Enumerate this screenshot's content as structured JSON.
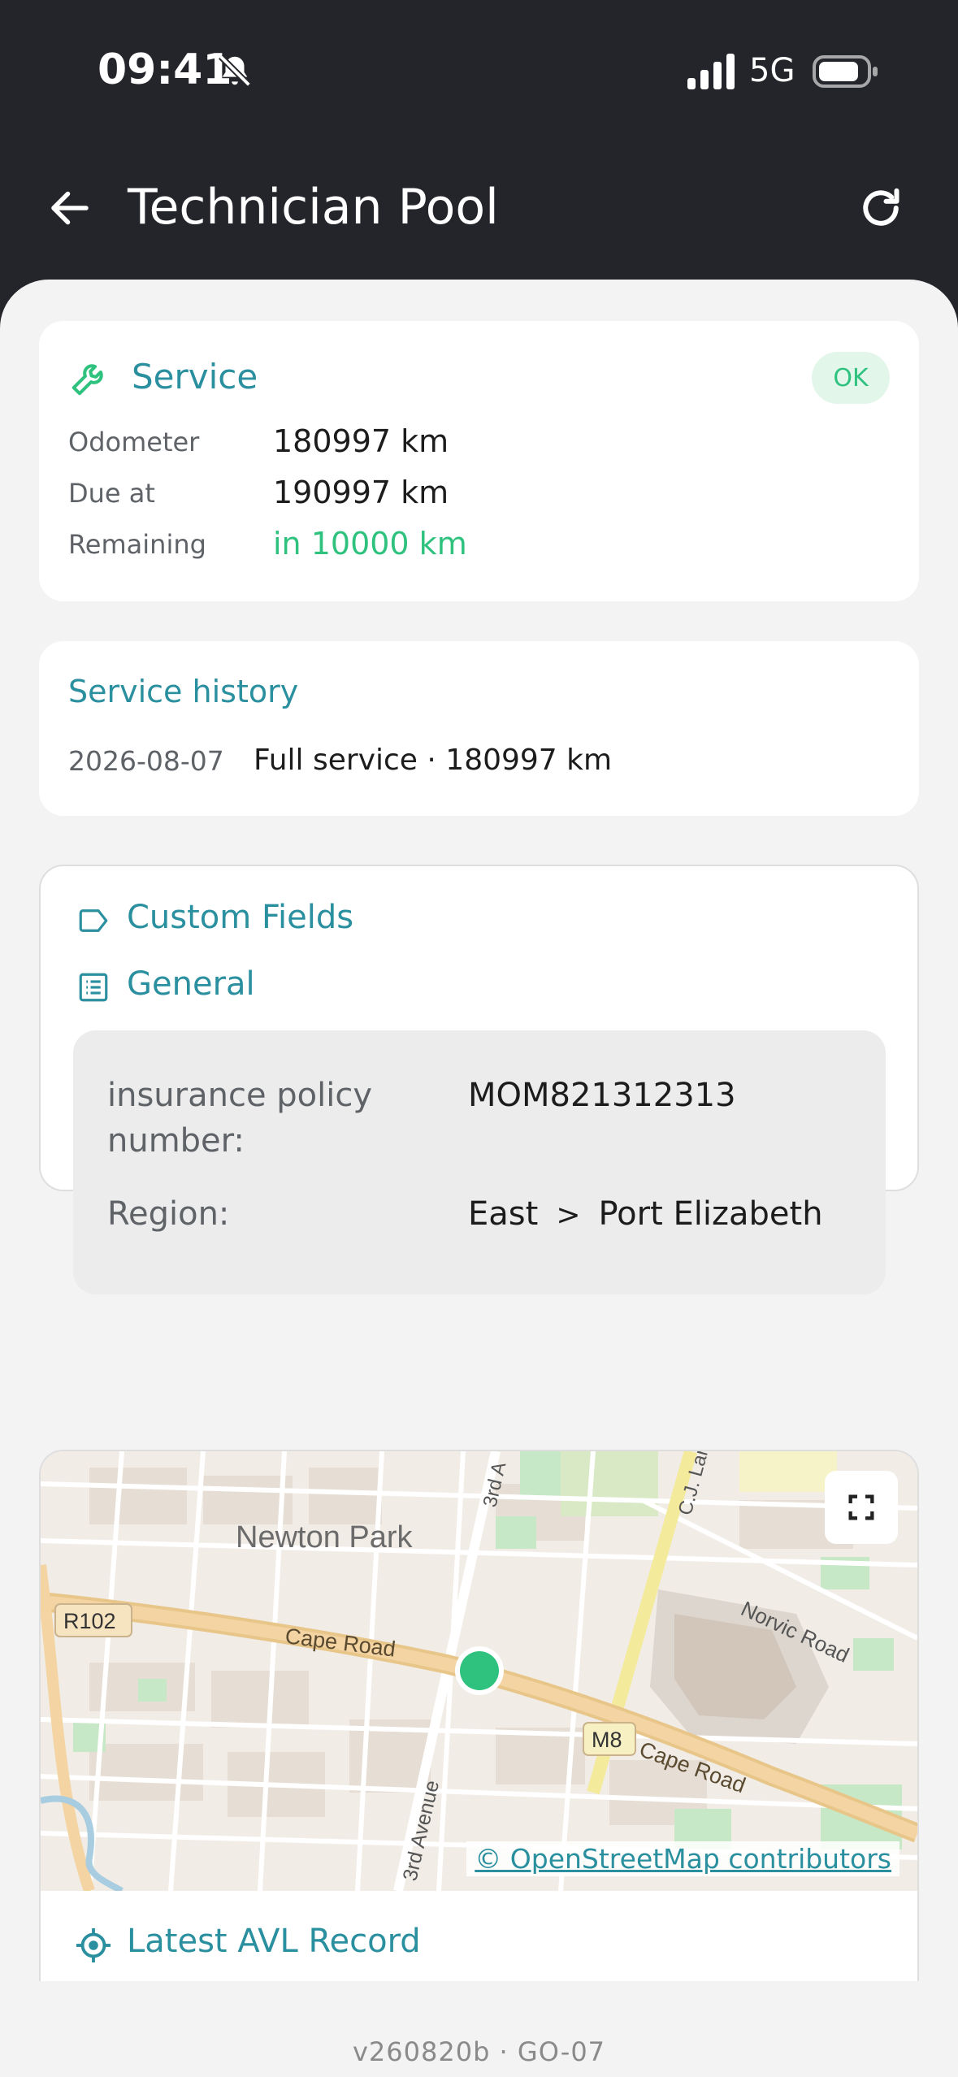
{
  "status_bar": {
    "time": "09:41",
    "network": "5G"
  },
  "header": {
    "title": "Technician Pool"
  },
  "service": {
    "title": "Service",
    "status": "OK",
    "rows": [
      {
        "label": "Odometer",
        "value": "180997 km"
      },
      {
        "label": "Due at",
        "value": "190997 km"
      },
      {
        "label": "Remaining",
        "value": "in 10000 km"
      }
    ]
  },
  "history": {
    "title": "Service history",
    "entries": [
      {
        "date": "2026-08-07",
        "description": "Full service · 180997 km"
      }
    ]
  },
  "custom_fields": {
    "title": "Custom Fields",
    "group_title": "General",
    "fields": [
      {
        "label": "insurance policy number:",
        "value": "MOM821312313"
      },
      {
        "label": "Region:",
        "value_parts": [
          "East",
          "Port Elizabeth"
        ],
        "separator": ">"
      }
    ]
  },
  "map": {
    "labels": {
      "area": "Newton Park",
      "road1": "Cape Road",
      "road2": "Cape Road",
      "route1": "R102",
      "route2": "M8",
      "road3": "Norvic Road",
      "road4": "3rd Avenue",
      "road5": "3rd A",
      "road6": "C.J. Lar"
    },
    "attribution": "© OpenStreetMap contributors",
    "marker_color": "#2ec27e"
  },
  "avl": {
    "title": "Latest AVL Record"
  },
  "footer": {
    "version": "v260820b · GO-07"
  },
  "colors": {
    "accent": "#2a8f9e",
    "success": "#2ec27e",
    "header_bg": "#24252b"
  }
}
